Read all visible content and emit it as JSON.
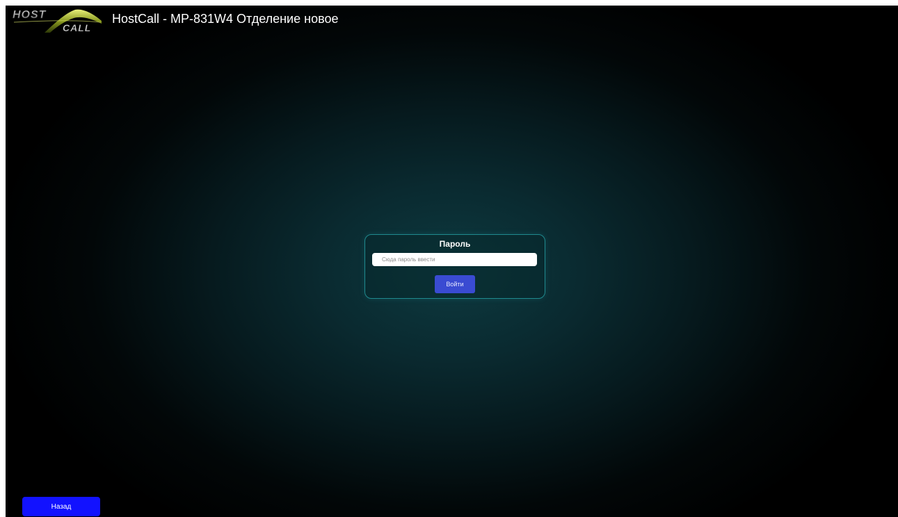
{
  "header": {
    "logo": {
      "icon": "hostcall-logo",
      "line1": "HOST",
      "line2": "CALL"
    },
    "title": "HostCall - MP-831W4 Отделение новое"
  },
  "login": {
    "title": "Пароль",
    "password_placeholder": "Сюда пароль ввести",
    "password_value": "",
    "submit_label": "Войти"
  },
  "footer": {
    "back_label": "Назад"
  },
  "colors": {
    "background_center": "#0d3a40",
    "background_edge": "#000000",
    "panel_border": "#1f8a8e",
    "submit_button": "#3a4bd2",
    "back_button": "#1212ff",
    "logo_green": "#8a9a20"
  }
}
